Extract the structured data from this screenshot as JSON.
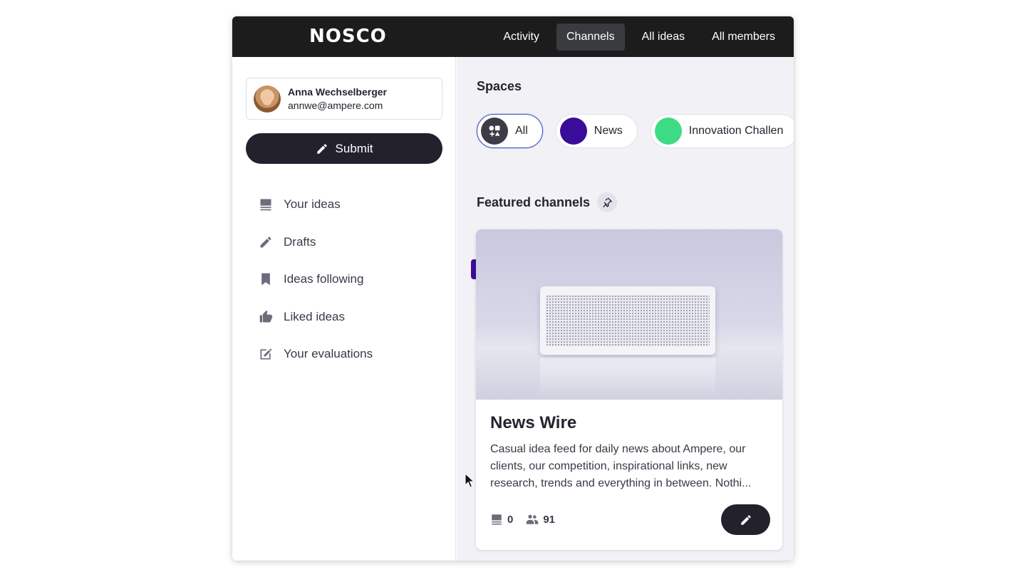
{
  "brand": {
    "logo": "NOSCO"
  },
  "nav": {
    "items": [
      {
        "label": "Activity",
        "active": false
      },
      {
        "label": "Channels",
        "active": true
      },
      {
        "label": "All ideas",
        "active": false
      },
      {
        "label": "All members",
        "active": false
      }
    ]
  },
  "user": {
    "name": "Anna Wechselberger",
    "email": "annwe@ampere.com"
  },
  "sidebar": {
    "submit_label": "Submit",
    "items": [
      {
        "label": "Your ideas",
        "icon": "list-icon"
      },
      {
        "label": "Drafts",
        "icon": "pencil-icon"
      },
      {
        "label": "Ideas following",
        "icon": "bookmark-icon"
      },
      {
        "label": "Liked ideas",
        "icon": "thumbs-up-icon"
      },
      {
        "label": "Your evaluations",
        "icon": "edit-square-icon"
      }
    ]
  },
  "spaces": {
    "title": "Spaces",
    "chips": [
      {
        "label": "All",
        "color": "#3c3b47",
        "active": true
      },
      {
        "label": "News",
        "color": "#3a0c9a",
        "active": false
      },
      {
        "label": "Innovation Challen",
        "color": "#3ddc84",
        "active": false
      }
    ]
  },
  "featured": {
    "title": "Featured channels",
    "card": {
      "title": "News Wire",
      "description": "Casual idea feed for daily news about Ampere, our clients, our competition, inspirational links, new research, trends and everything in between. Nothi...",
      "ideas_count": "0",
      "members_count": "91",
      "tag_color": "#3a0c9a"
    }
  },
  "colors": {
    "topbar": "#1c1c1c",
    "accent": "#4a57b8",
    "dark_button": "#23212c",
    "main_bg": "#f2f1f6"
  }
}
